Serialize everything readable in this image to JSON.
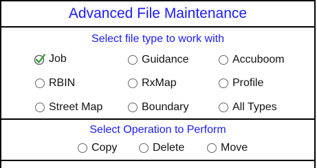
{
  "title": "Advanced File Maintenance",
  "file_type_section": {
    "heading": "Select file type to work with",
    "options": [
      {
        "label": "Job",
        "checked": true
      },
      {
        "label": "Guidance",
        "checked": false
      },
      {
        "label": "Accuboom",
        "checked": false
      },
      {
        "label": "RBIN",
        "checked": false
      },
      {
        "label": "RxMap",
        "checked": false
      },
      {
        "label": "Profile",
        "checked": false
      },
      {
        "label": "Street Map",
        "checked": false
      },
      {
        "label": "Boundary",
        "checked": false
      },
      {
        "label": "All Types",
        "checked": false
      }
    ]
  },
  "operation_section": {
    "heading": "Select Operation to Perform",
    "options": [
      {
        "label": "Copy",
        "checked": false
      },
      {
        "label": "Delete",
        "checked": false
      },
      {
        "label": "Move",
        "checked": false
      }
    ]
  },
  "colors": {
    "heading": "#1a1aff",
    "check": "#3aa23a",
    "border": "#000000"
  }
}
